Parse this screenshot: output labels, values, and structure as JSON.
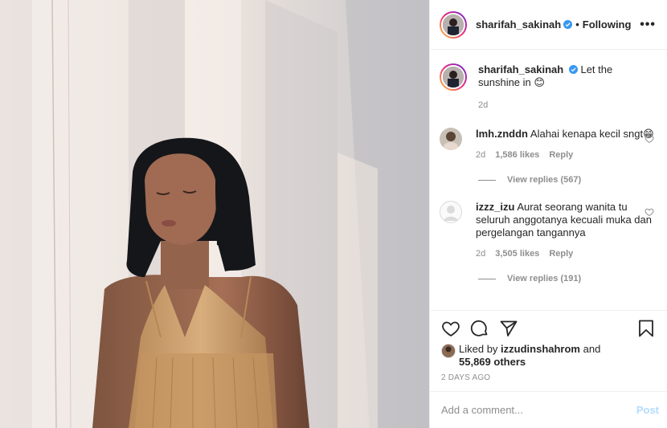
{
  "header": {
    "username": "sharifah_sakinah",
    "separator": "•",
    "follow_status": "Following",
    "more_label": "•••"
  },
  "caption": {
    "username": "sharifah_sakinah",
    "text": "Let the sunshine in 😊",
    "time": "2d"
  },
  "comments": [
    {
      "username": "lmh.znddn",
      "text": "Alahai kenapa kecil sngt😁",
      "time": "2d",
      "likes": "1,586 likes",
      "reply_label": "Reply",
      "view_replies": "View replies (567)"
    },
    {
      "username": "izzz_izu",
      "text": "Aurat seorang wanita tu seluruh anggotanya kecuali muka dan pergelangan tangannya",
      "time": "2d",
      "likes": "3,505 likes",
      "reply_label": "Reply",
      "view_replies": "View replies (191)"
    }
  ],
  "likes_summary": {
    "prefix": "Liked by ",
    "username": "izzudinshahrom",
    "suffix": " and",
    "others": "55,869 others"
  },
  "timestamp": "2 DAYS AGO",
  "comment_input": {
    "placeholder": "Add a comment...",
    "post_label": "Post"
  },
  "icons": {
    "like": "heart-icon",
    "comment": "comment-bubble-icon",
    "share": "paper-plane-icon",
    "save": "bookmark-icon",
    "verified": "verified-badge-icon"
  },
  "colors": {
    "verified": "#3897f0",
    "post_button": "#b3dbff",
    "muted": "#8e8e8e"
  }
}
